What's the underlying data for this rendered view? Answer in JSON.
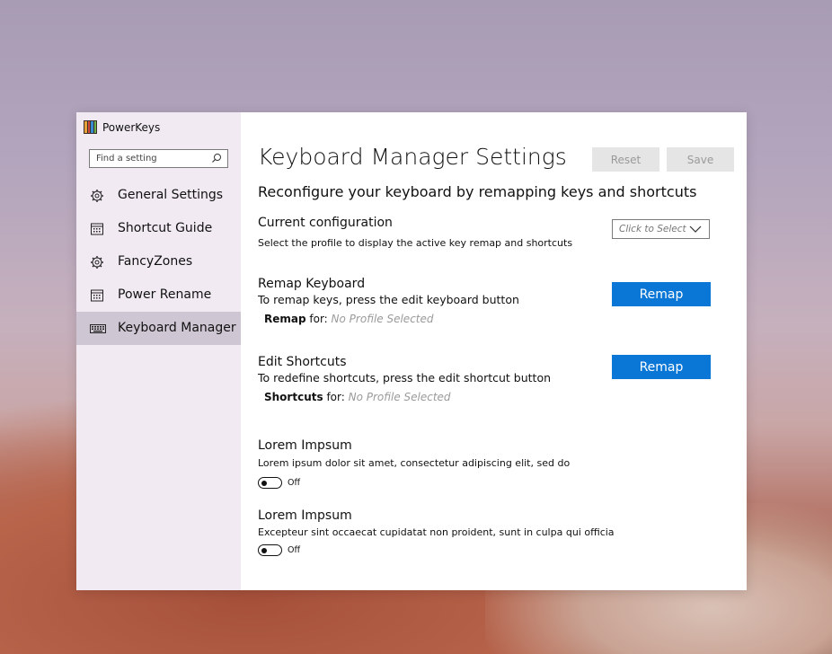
{
  "app": {
    "title": "PowerKeys",
    "logo_colors": [
      "#e8a23a",
      "#d24a3a",
      "#3a8ad2",
      "#6cb04a"
    ]
  },
  "search": {
    "placeholder": "Find a setting"
  },
  "nav": {
    "items": [
      {
        "label": "General Settings",
        "icon": "gear-icon"
      },
      {
        "label": "Shortcut Guide",
        "icon": "calendar-icon"
      },
      {
        "label": "FancyZones",
        "icon": "gear-icon"
      },
      {
        "label": "Power Rename",
        "icon": "calendar-icon"
      },
      {
        "label": "Keyboard Manager",
        "icon": "keyboard-icon",
        "active": true
      }
    ]
  },
  "main": {
    "title": "Keyboard Manager Settings",
    "reset_label": "Reset",
    "save_label": "Save",
    "subtitle": "Reconfigure your keyboard by remapping keys and shortcuts",
    "current_config": {
      "title": "Current configuration",
      "desc": "Select the profile to display the active key remap and shortcuts",
      "dropdown_value": "Click to Select"
    },
    "remap_keyboard": {
      "title": "Remap Keyboard",
      "desc": "To remap keys, press the edit keyboard button",
      "button_label": "Remap",
      "for_label": "Remap",
      "for_suffix": " for: ",
      "for_value": "No Profile Selected"
    },
    "edit_shortcuts": {
      "title": "Edit Shortcuts",
      "desc": "To redefine shortcuts, press the edit shortcut button",
      "button_label": "Remap",
      "for_label": "Shortcuts",
      "for_suffix": " for: ",
      "for_value": "No Profile Selected"
    },
    "lorem1": {
      "title": "Lorem Impsum",
      "desc": "Lorem ipsum dolor sit amet, consectetur adipiscing elit, sed do",
      "toggle_label": "Off"
    },
    "lorem2": {
      "title": "Lorem Impsum",
      "desc": "Excepteur sint occaecat cupidatat non proident, sunt in culpa qui officia",
      "toggle_label": "Off"
    }
  },
  "colors": {
    "accent": "#0a76d6",
    "sidebar_bg": "#f0e8f2",
    "active_item": "#cfc6d3"
  }
}
